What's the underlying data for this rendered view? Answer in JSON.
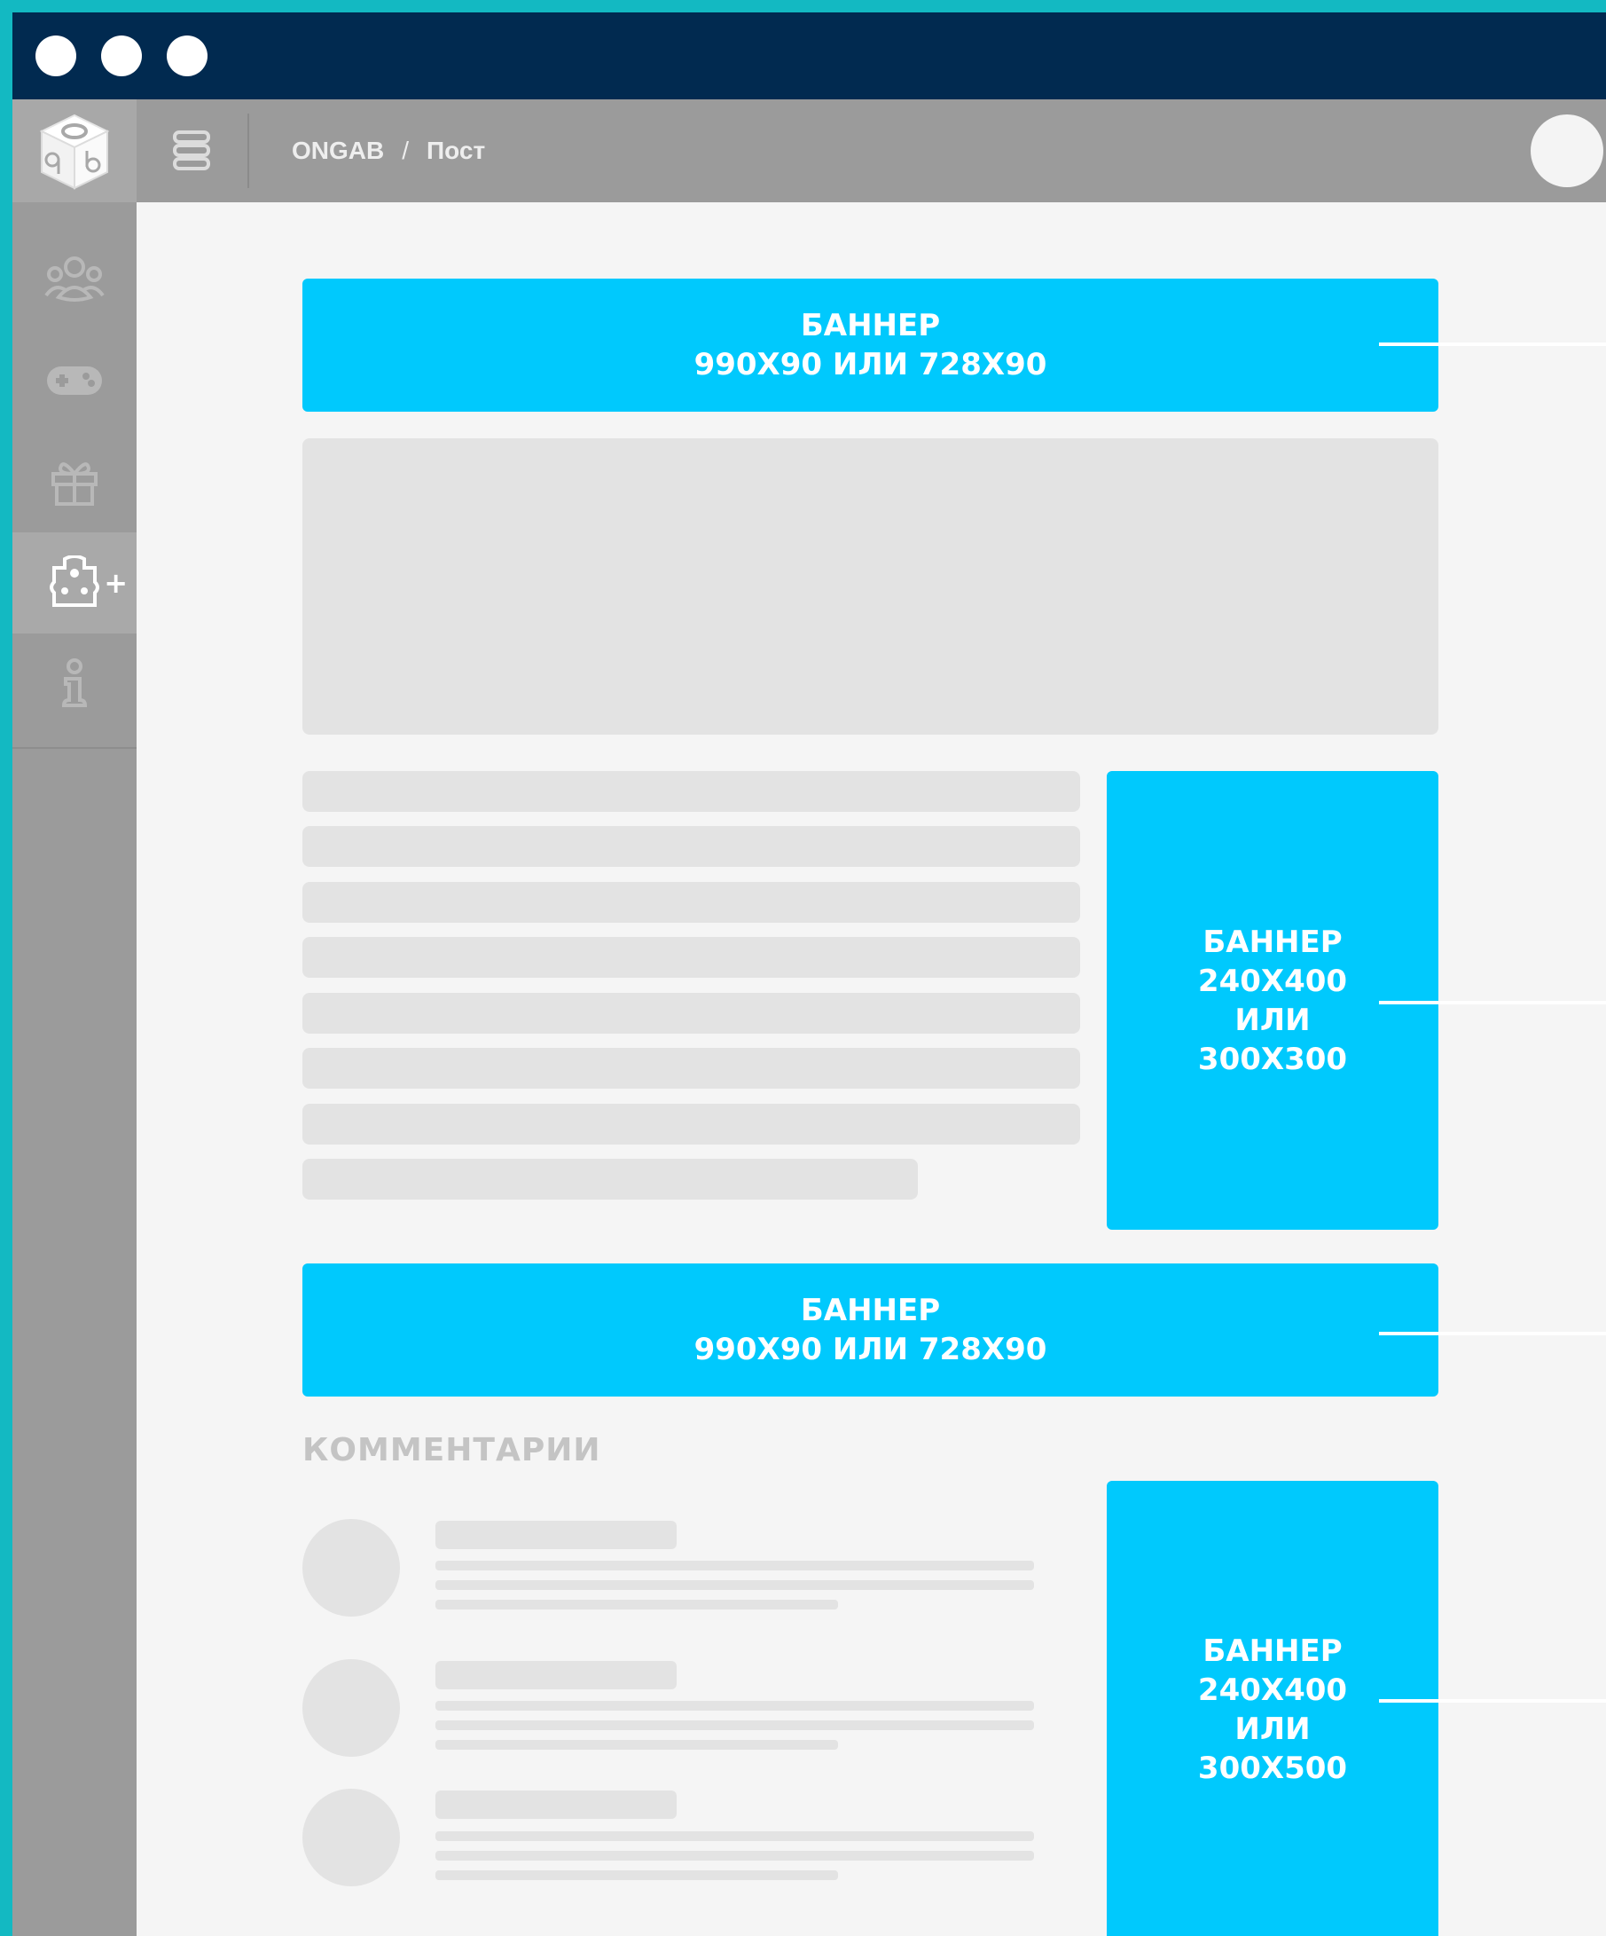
{
  "window": {
    "traffic_lights": [
      "close",
      "minimize",
      "maximize"
    ]
  },
  "breadcrumb": {
    "root": "ONGAB",
    "separator": "/",
    "current": "Пост"
  },
  "sidebar": {
    "items": [
      {
        "icon": "users-icon",
        "active": false
      },
      {
        "icon": "gamepad-icon",
        "active": false
      },
      {
        "icon": "gift-icon",
        "active": false
      },
      {
        "icon": "puzzle-icon",
        "active": true,
        "badge": "+"
      },
      {
        "icon": "info-icon",
        "active": false
      }
    ]
  },
  "banners": {
    "top": {
      "line1": "БАННЕР",
      "line2": "990Х90 ИЛИ 728Х90"
    },
    "side1": {
      "line1": "БАННЕР",
      "line2": "240Х400",
      "line3": "ИЛИ",
      "line4": "300Х300"
    },
    "bottom": {
      "line1": "БАННЕР",
      "line2": "990Х90 ИЛИ 728Х90"
    },
    "side2": {
      "line1": "БАННЕР",
      "line2": "240Х400",
      "line3": "ИЛИ",
      "line4": "300Х500"
    }
  },
  "comments": {
    "title": "КОММЕНТАРИИ"
  },
  "colors": {
    "accent": "#00c9fd",
    "titlebar": "#012a50",
    "background": "#13b9c2",
    "placeholder": "#e3e3e3"
  }
}
